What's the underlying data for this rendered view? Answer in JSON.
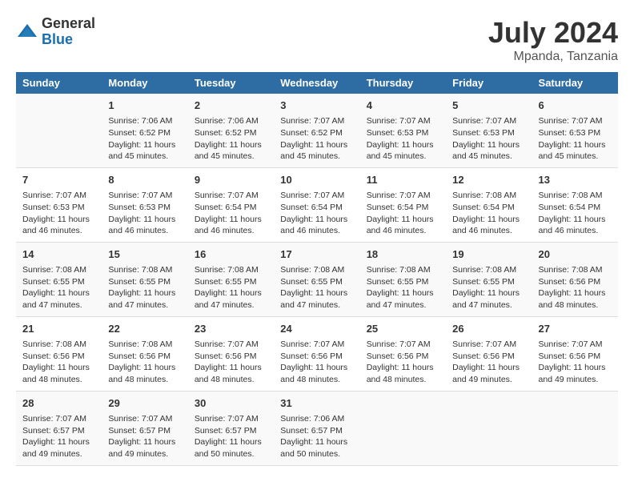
{
  "header": {
    "logo_line1": "General",
    "logo_line2": "Blue",
    "month_year": "July 2024",
    "location": "Mpanda, Tanzania"
  },
  "days_of_week": [
    "Sunday",
    "Monday",
    "Tuesday",
    "Wednesday",
    "Thursday",
    "Friday",
    "Saturday"
  ],
  "weeks": [
    [
      {
        "day": "",
        "sunrise": "",
        "sunset": "",
        "daylight": ""
      },
      {
        "day": "1",
        "sunrise": "Sunrise: 7:06 AM",
        "sunset": "Sunset: 6:52 PM",
        "daylight": "Daylight: 11 hours and 45 minutes."
      },
      {
        "day": "2",
        "sunrise": "Sunrise: 7:06 AM",
        "sunset": "Sunset: 6:52 PM",
        "daylight": "Daylight: 11 hours and 45 minutes."
      },
      {
        "day": "3",
        "sunrise": "Sunrise: 7:07 AM",
        "sunset": "Sunset: 6:52 PM",
        "daylight": "Daylight: 11 hours and 45 minutes."
      },
      {
        "day": "4",
        "sunrise": "Sunrise: 7:07 AM",
        "sunset": "Sunset: 6:53 PM",
        "daylight": "Daylight: 11 hours and 45 minutes."
      },
      {
        "day": "5",
        "sunrise": "Sunrise: 7:07 AM",
        "sunset": "Sunset: 6:53 PM",
        "daylight": "Daylight: 11 hours and 45 minutes."
      },
      {
        "day": "6",
        "sunrise": "Sunrise: 7:07 AM",
        "sunset": "Sunset: 6:53 PM",
        "daylight": "Daylight: 11 hours and 45 minutes."
      }
    ],
    [
      {
        "day": "7",
        "sunrise": "Sunrise: 7:07 AM",
        "sunset": "Sunset: 6:53 PM",
        "daylight": "Daylight: 11 hours and 46 minutes."
      },
      {
        "day": "8",
        "sunrise": "Sunrise: 7:07 AM",
        "sunset": "Sunset: 6:53 PM",
        "daylight": "Daylight: 11 hours and 46 minutes."
      },
      {
        "day": "9",
        "sunrise": "Sunrise: 7:07 AM",
        "sunset": "Sunset: 6:54 PM",
        "daylight": "Daylight: 11 hours and 46 minutes."
      },
      {
        "day": "10",
        "sunrise": "Sunrise: 7:07 AM",
        "sunset": "Sunset: 6:54 PM",
        "daylight": "Daylight: 11 hours and 46 minutes."
      },
      {
        "day": "11",
        "sunrise": "Sunrise: 7:07 AM",
        "sunset": "Sunset: 6:54 PM",
        "daylight": "Daylight: 11 hours and 46 minutes."
      },
      {
        "day": "12",
        "sunrise": "Sunrise: 7:08 AM",
        "sunset": "Sunset: 6:54 PM",
        "daylight": "Daylight: 11 hours and 46 minutes."
      },
      {
        "day": "13",
        "sunrise": "Sunrise: 7:08 AM",
        "sunset": "Sunset: 6:54 PM",
        "daylight": "Daylight: 11 hours and 46 minutes."
      }
    ],
    [
      {
        "day": "14",
        "sunrise": "Sunrise: 7:08 AM",
        "sunset": "Sunset: 6:55 PM",
        "daylight": "Daylight: 11 hours and 47 minutes."
      },
      {
        "day": "15",
        "sunrise": "Sunrise: 7:08 AM",
        "sunset": "Sunset: 6:55 PM",
        "daylight": "Daylight: 11 hours and 47 minutes."
      },
      {
        "day": "16",
        "sunrise": "Sunrise: 7:08 AM",
        "sunset": "Sunset: 6:55 PM",
        "daylight": "Daylight: 11 hours and 47 minutes."
      },
      {
        "day": "17",
        "sunrise": "Sunrise: 7:08 AM",
        "sunset": "Sunset: 6:55 PM",
        "daylight": "Daylight: 11 hours and 47 minutes."
      },
      {
        "day": "18",
        "sunrise": "Sunrise: 7:08 AM",
        "sunset": "Sunset: 6:55 PM",
        "daylight": "Daylight: 11 hours and 47 minutes."
      },
      {
        "day": "19",
        "sunrise": "Sunrise: 7:08 AM",
        "sunset": "Sunset: 6:55 PM",
        "daylight": "Daylight: 11 hours and 47 minutes."
      },
      {
        "day": "20",
        "sunrise": "Sunrise: 7:08 AM",
        "sunset": "Sunset: 6:56 PM",
        "daylight": "Daylight: 11 hours and 48 minutes."
      }
    ],
    [
      {
        "day": "21",
        "sunrise": "Sunrise: 7:08 AM",
        "sunset": "Sunset: 6:56 PM",
        "daylight": "Daylight: 11 hours and 48 minutes."
      },
      {
        "day": "22",
        "sunrise": "Sunrise: 7:08 AM",
        "sunset": "Sunset: 6:56 PM",
        "daylight": "Daylight: 11 hours and 48 minutes."
      },
      {
        "day": "23",
        "sunrise": "Sunrise: 7:07 AM",
        "sunset": "Sunset: 6:56 PM",
        "daylight": "Daylight: 11 hours and 48 minutes."
      },
      {
        "day": "24",
        "sunrise": "Sunrise: 7:07 AM",
        "sunset": "Sunset: 6:56 PM",
        "daylight": "Daylight: 11 hours and 48 minutes."
      },
      {
        "day": "25",
        "sunrise": "Sunrise: 7:07 AM",
        "sunset": "Sunset: 6:56 PM",
        "daylight": "Daylight: 11 hours and 48 minutes."
      },
      {
        "day": "26",
        "sunrise": "Sunrise: 7:07 AM",
        "sunset": "Sunset: 6:56 PM",
        "daylight": "Daylight: 11 hours and 49 minutes."
      },
      {
        "day": "27",
        "sunrise": "Sunrise: 7:07 AM",
        "sunset": "Sunset: 6:56 PM",
        "daylight": "Daylight: 11 hours and 49 minutes."
      }
    ],
    [
      {
        "day": "28",
        "sunrise": "Sunrise: 7:07 AM",
        "sunset": "Sunset: 6:57 PM",
        "daylight": "Daylight: 11 hours and 49 minutes."
      },
      {
        "day": "29",
        "sunrise": "Sunrise: 7:07 AM",
        "sunset": "Sunset: 6:57 PM",
        "daylight": "Daylight: 11 hours and 49 minutes."
      },
      {
        "day": "30",
        "sunrise": "Sunrise: 7:07 AM",
        "sunset": "Sunset: 6:57 PM",
        "daylight": "Daylight: 11 hours and 50 minutes."
      },
      {
        "day": "31",
        "sunrise": "Sunrise: 7:06 AM",
        "sunset": "Sunset: 6:57 PM",
        "daylight": "Daylight: 11 hours and 50 minutes."
      },
      {
        "day": "",
        "sunrise": "",
        "sunset": "",
        "daylight": ""
      },
      {
        "day": "",
        "sunrise": "",
        "sunset": "",
        "daylight": ""
      },
      {
        "day": "",
        "sunrise": "",
        "sunset": "",
        "daylight": ""
      }
    ]
  ]
}
